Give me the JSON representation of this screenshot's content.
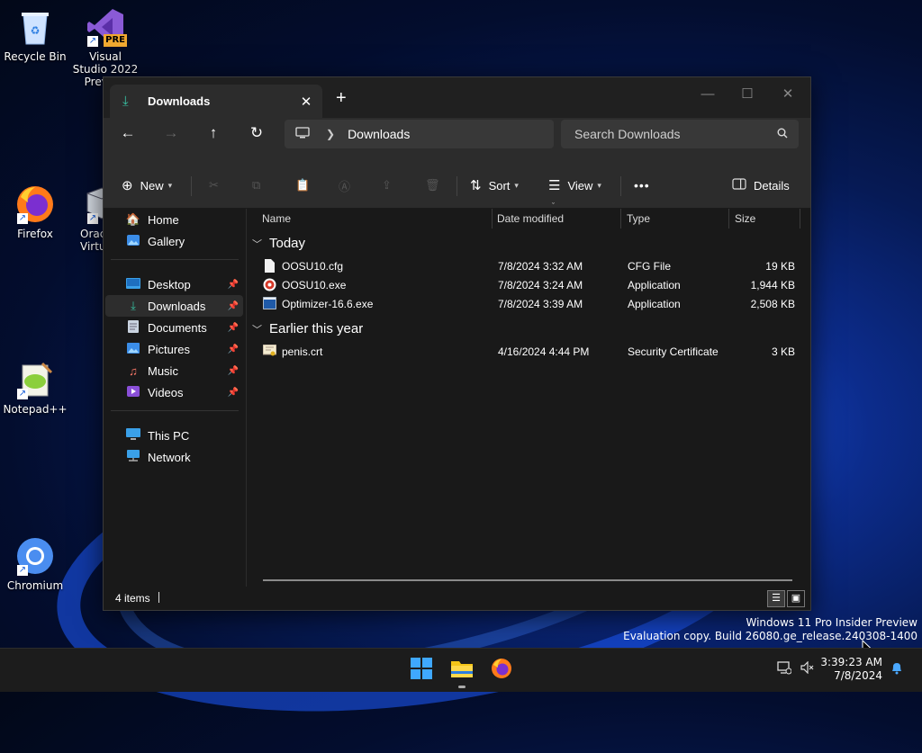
{
  "desktop": {
    "icons": [
      {
        "label": "Recycle Bin",
        "icon": "recycle-bin-icon"
      },
      {
        "label": "Visual Studio 2022 Preview",
        "badge": "PRE",
        "icon": "visual-studio-icon"
      },
      {
        "label": "Firefox",
        "icon": "firefox-icon"
      },
      {
        "label": "Oracle VM VirtualBox",
        "visible_label": "Orac\nVirtu",
        "icon": "virtualbox-icon"
      },
      {
        "label": "Notepad++",
        "icon": "notepad-plus-plus-icon"
      },
      {
        "label": "Chromium",
        "icon": "chromium-icon"
      }
    ]
  },
  "window": {
    "tab_title": "Downloads",
    "new_tab": "+",
    "tab_close": "✕",
    "controls": {
      "minimize": "—",
      "maximize": "☐",
      "close": "✕"
    },
    "address": {
      "segment": "Downloads"
    },
    "search": {
      "placeholder": "Search Downloads"
    },
    "commands": {
      "new": "New",
      "sort": "Sort",
      "view": "View",
      "more": "•••",
      "details": "Details"
    },
    "sidebar": {
      "items": [
        {
          "label": "Home",
          "icon": "home-icon"
        },
        {
          "label": "Gallery",
          "icon": "gallery-icon"
        },
        {
          "label": "Desktop",
          "icon": "desktop-icon",
          "pinned": true
        },
        {
          "label": "Downloads",
          "icon": "downloads-icon",
          "pinned": true,
          "selected": true
        },
        {
          "label": "Documents",
          "icon": "documents-icon",
          "pinned": true
        },
        {
          "label": "Pictures",
          "icon": "pictures-icon",
          "pinned": true
        },
        {
          "label": "Music",
          "icon": "music-icon",
          "pinned": true
        },
        {
          "label": "Videos",
          "icon": "videos-icon",
          "pinned": true
        },
        {
          "label": "This PC",
          "icon": "this-pc-icon"
        },
        {
          "label": "Network",
          "icon": "network-icon"
        }
      ]
    },
    "columns": [
      "Name",
      "Date modified",
      "Type",
      "Size"
    ],
    "groups": [
      {
        "title": "Today",
        "files": [
          {
            "name": "OOSU10.cfg",
            "date": "7/8/2024 3:32 AM",
            "type": "CFG File",
            "size": "19 KB",
            "icon": "cfg-file-icon"
          },
          {
            "name": "OOSU10.exe",
            "date": "7/8/2024 3:24 AM",
            "type": "Application",
            "size": "1,944 KB",
            "icon": "oosu-app-icon"
          },
          {
            "name": "Optimizer-16.6.exe",
            "date": "7/8/2024 3:39 AM",
            "type": "Application",
            "size": "2,508 KB",
            "icon": "optimizer-app-icon"
          }
        ]
      },
      {
        "title": "Earlier this year",
        "files": [
          {
            "name": "penis.crt",
            "date": "4/16/2024 4:44 PM",
            "type": "Security Certificate",
            "size": "3 KB",
            "icon": "certificate-icon"
          }
        ]
      }
    ],
    "status": {
      "item_count": "4 items"
    }
  },
  "watermark": {
    "line1": "Windows 11 Pro Insider Preview",
    "line2": "Evaluation copy. Build 26080.ge_release.240308-1400"
  },
  "taskbar": {
    "time": "3:39:23 AM",
    "date": "7/8/2024"
  },
  "colors": {
    "accent": "#38c0a2",
    "window_bg": "#191919",
    "chrome_bg": "#2c2c2c",
    "taskbar_bg": "#1c1c1c"
  }
}
